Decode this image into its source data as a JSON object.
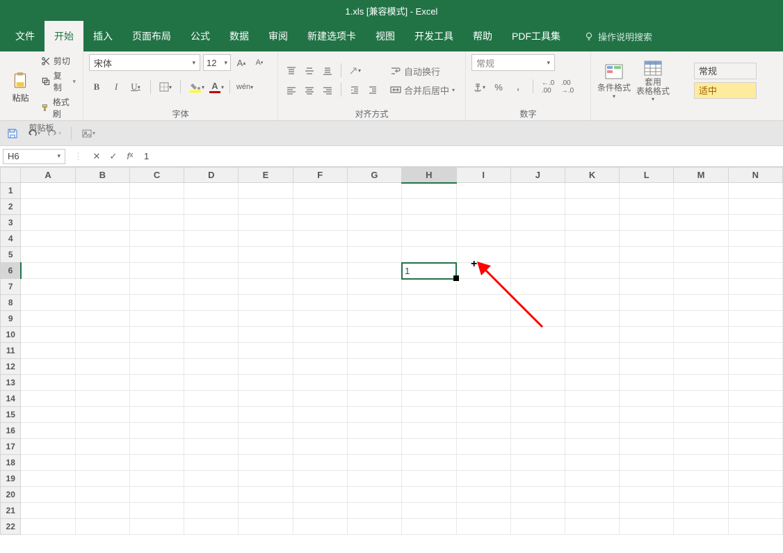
{
  "title": "1.xls  [兼容模式]  -  Excel",
  "tabs": [
    "文件",
    "开始",
    "插入",
    "页面布局",
    "公式",
    "数据",
    "审阅",
    "新建选项卡",
    "视图",
    "开发工具",
    "帮助",
    "PDF工具集"
  ],
  "active_tab_index": 1,
  "tell_me": "操作说明搜索",
  "clipboard": {
    "paste": "粘贴",
    "cut": "剪切",
    "copy": "复制",
    "format_painter": "格式刷",
    "group": "剪贴板"
  },
  "font": {
    "name": "宋体",
    "size": "12",
    "group": "字体"
  },
  "alignment": {
    "wrap": "自动换行",
    "merge": "合并后居中",
    "group": "对齐方式"
  },
  "number": {
    "format": "常规",
    "group": "数字"
  },
  "styles": {
    "conditional": "条件格式",
    "table": "套用\n表格格式",
    "normal": "常规",
    "good": "适中"
  },
  "name_box": "H6",
  "formula_value": "1",
  "columns": [
    "A",
    "B",
    "C",
    "D",
    "E",
    "F",
    "G",
    "H",
    "I",
    "J",
    "K",
    "L",
    "M",
    "N"
  ],
  "rows": [
    "1",
    "2",
    "3",
    "4",
    "5",
    "6",
    "7",
    "8",
    "9",
    "10",
    "11",
    "12",
    "13",
    "14",
    "15",
    "16",
    "17",
    "18",
    "19",
    "20",
    "21",
    "22"
  ],
  "active_cell": {
    "row": 5,
    "col": 7,
    "value": "1"
  }
}
